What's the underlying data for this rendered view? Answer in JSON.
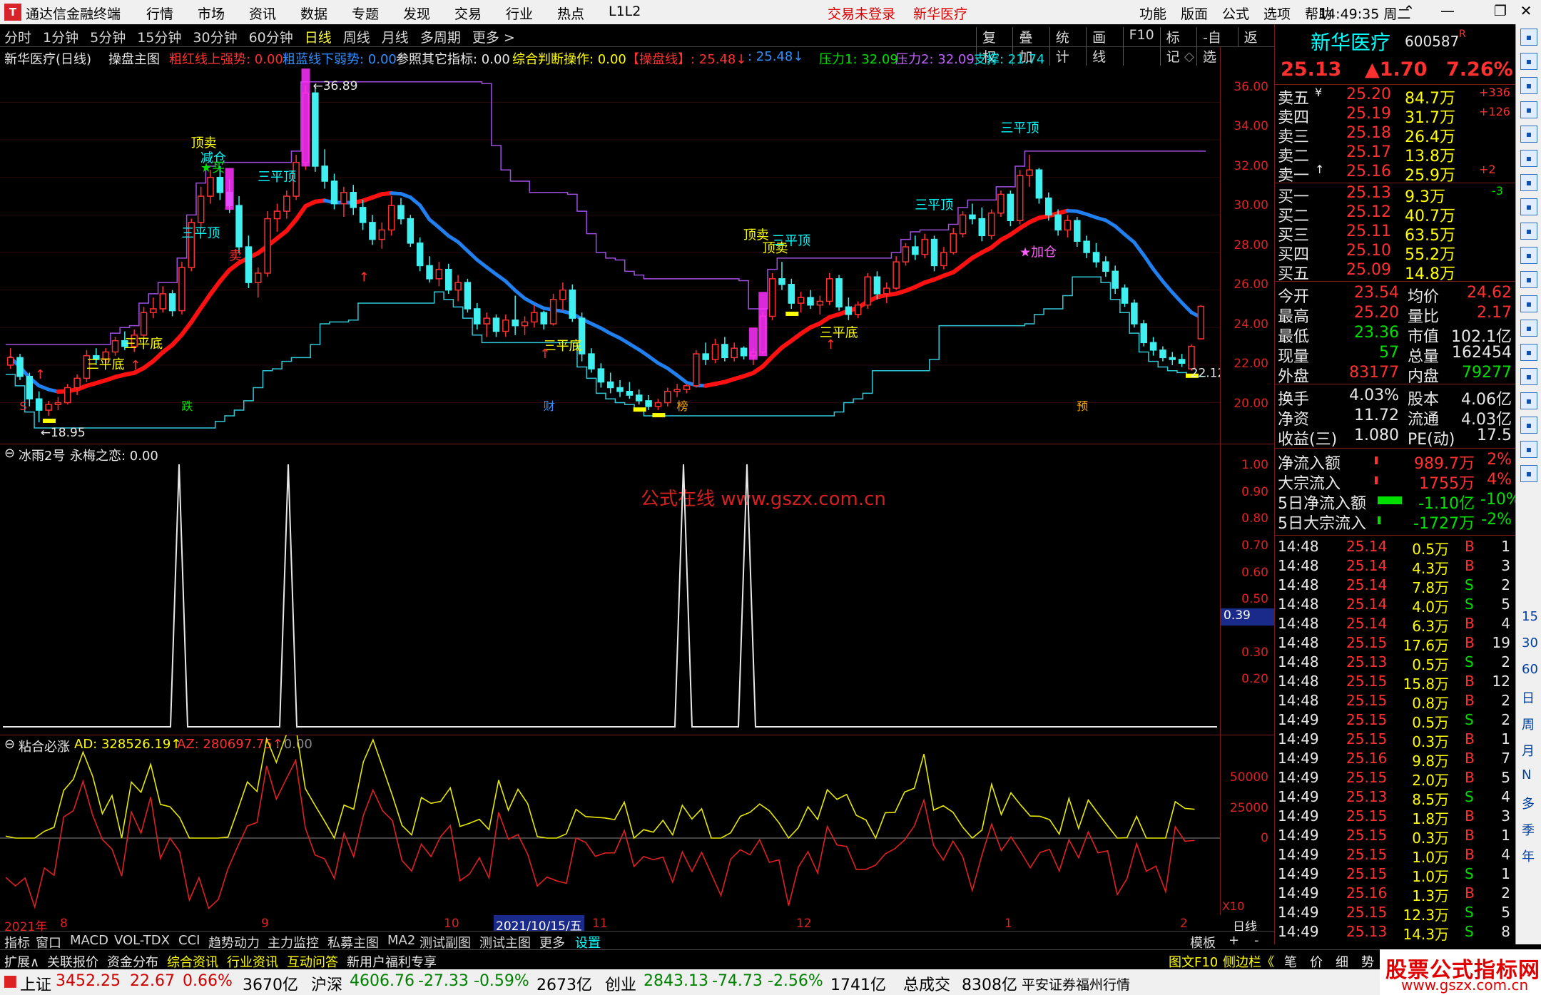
{
  "window": {
    "app_title": "通达信金融终端",
    "logo_glyph": "T",
    "menus": [
      "行情",
      "市场",
      "资讯",
      "数据",
      "专题",
      "发现",
      "交易",
      "行业",
      "热点",
      "L1L2"
    ],
    "alert_login": "交易未登录",
    "alert_stock": "新华医疗",
    "right_menus": [
      "功能",
      "版面",
      "公式",
      "选项",
      "帮助"
    ],
    "clock": "14:49:35 周二"
  },
  "toolbar": {
    "period_tabs": [
      "分时",
      "1分钟",
      "5分钟",
      "15分钟",
      "30分钟",
      "60分钟",
      "日线",
      "周线",
      "月线",
      "多周期",
      "更多 >"
    ],
    "active_tab": "日线",
    "right_tools": [
      "复权",
      "叠加",
      "统计",
      "画线",
      "F10",
      "标记",
      "-自选",
      "返回"
    ]
  },
  "main_chart": {
    "title": "新华医疗(日线)",
    "indicator_name": "操盘主图",
    "fields": [
      {
        "label": "粗红线上强势: 0.00",
        "color": "#ff3030"
      },
      {
        "label": "粗蓝线下弱势: 0.00",
        "color": "#3090ff"
      },
      {
        "label": "参照其它指标: 0.00",
        "color": "#e8e8e8"
      },
      {
        "label": "综合判断操作: 0.00",
        "color": "#ffff00"
      },
      {
        "label": "【操盘线】: 25.48↓",
        "color": "#ff3030"
      },
      {
        "label": ": 25.48↓",
        "color": "#3090ff"
      },
      {
        "label": "压力1: 32.09",
        "color": "#00e000"
      },
      {
        "label": "压力2: 32.09",
        "color": "#c060ff"
      },
      {
        "label": "支撑: 21.74",
        "color": "#00e0e0"
      }
    ],
    "y_axis": [
      "36.00",
      "34.00",
      "32.00",
      "30.00",
      "28.00",
      "26.00",
      "24.00",
      "22.00",
      "20.00"
    ],
    "high_label": "36.89",
    "low_label": "18.95",
    "last_label": "22.12",
    "annotations": [
      {
        "text": "顶卖",
        "color": "#ffff00"
      },
      {
        "text": "减仓",
        "color": "#00ffff"
      },
      {
        "text": "★买",
        "color": "#00e000"
      },
      {
        "text": "三平顶",
        "color": "#00ffff"
      },
      {
        "text": "三平顶",
        "color": "#00ffff"
      },
      {
        "text": "卖",
        "color": "#ff3030"
      },
      {
        "text": "三平底",
        "color": "#ffff00"
      },
      {
        "text": "三平底",
        "color": "#ffff00"
      },
      {
        "text": "三平底",
        "color": "#ffff00"
      },
      {
        "text": "顶卖",
        "color": "#ffff00"
      },
      {
        "text": "三平顶",
        "color": "#00ffff"
      },
      {
        "text": "顶卖",
        "color": "#ffff00"
      },
      {
        "text": "三平底",
        "color": "#ffff00"
      },
      {
        "text": "三平顶",
        "color": "#00ffff"
      },
      {
        "text": "三平顶",
        "color": "#00ffff"
      },
      {
        "text": "★加仓",
        "color": "#ff60ff"
      },
      {
        "text": "跌",
        "color": "#00e000"
      },
      {
        "text": "财",
        "color": "#3090ff"
      },
      {
        "text": "榜",
        "color": "#ffaa00"
      },
      {
        "text": "预",
        "color": "#ffaa00"
      },
      {
        "text": "S",
        "color": "#ff3030"
      }
    ]
  },
  "sub1": {
    "title": "冰雨2号",
    "field": "永梅之恋: 0.00",
    "y_axis": [
      "1.00",
      "0.90",
      "0.80",
      "0.70",
      "0.60",
      "0.50",
      "0.39",
      "0.30",
      "0.20"
    ],
    "watermark": "公式在线  www.gszx.com.cn"
  },
  "sub2": {
    "title": "粘合必涨",
    "ad": "AD: 328526.19↑",
    "az": "AZ: 280697.75↑",
    "zero": ": 0.00",
    "y_axis": [
      "50000",
      "25000",
      "0"
    ],
    "scale": "X10"
  },
  "date_axis": [
    "2021年",
    "8",
    "9",
    "10",
    "2021/10/15/五",
    "11",
    "12",
    "1",
    "2"
  ],
  "date_axis_right": "日线",
  "bottom_tabs1": [
    "指标",
    "窗口",
    "MACD",
    "VOL-TDX",
    "CCI",
    "趋势动力",
    "主力监控",
    "私募主图",
    "MA2",
    "测试副图",
    "测试主图",
    "更多",
    "设置"
  ],
  "bottom_tabs1_right": [
    "模板",
    "+",
    "-"
  ],
  "bottom_tabs2": [
    "扩展∧",
    "关联报价",
    "资金分布",
    "综合资讯",
    "行业资讯",
    "互动问答",
    "新用户福利专享"
  ],
  "bottom_tabs2_right": [
    "图文F10",
    "侧边栏《",
    "笔",
    "价",
    "细",
    "势"
  ],
  "quote": {
    "name": "新华医疗",
    "code": "600587",
    "code_flag": "R",
    "price": "25.13",
    "change": "▲1.70",
    "pct": "7.26%",
    "asks": [
      {
        "label": "卖五",
        "mark": "¥",
        "price": "25.20",
        "vol": "84.7万",
        "delta": "+336"
      },
      {
        "label": "卖四",
        "mark": "",
        "price": "25.19",
        "vol": "31.7万",
        "delta": "+126"
      },
      {
        "label": "卖三",
        "mark": "",
        "price": "25.18",
        "vol": "26.4万",
        "delta": ""
      },
      {
        "label": "卖二",
        "mark": "",
        "price": "25.17",
        "vol": "13.8万",
        "delta": ""
      },
      {
        "label": "卖一",
        "mark": "↑",
        "price": "25.16",
        "vol": "25.9万",
        "delta": "+2"
      }
    ],
    "bids": [
      {
        "label": "买一",
        "price": "25.13",
        "vol": "9.3万",
        "delta": "-3"
      },
      {
        "label": "买二",
        "price": "25.12",
        "vol": "40.7万",
        "delta": ""
      },
      {
        "label": "买三",
        "price": "25.11",
        "vol": "63.5万",
        "delta": ""
      },
      {
        "label": "买四",
        "price": "25.10",
        "vol": "55.2万",
        "delta": ""
      },
      {
        "label": "买五",
        "price": "25.09",
        "vol": "14.8万",
        "delta": ""
      }
    ],
    "stats": [
      {
        "l1": "今开",
        "v1": "23.54",
        "c1": "#ff3030",
        "l2": "均价",
        "v2": "24.62",
        "c2": "#ff3030"
      },
      {
        "l1": "最高",
        "v1": "25.20",
        "c1": "#ff3030",
        "l2": "量比",
        "v2": "2.17",
        "c2": "#ff3030"
      },
      {
        "l1": "最低",
        "v1": "23.36",
        "c1": "#00e000",
        "l2": "市值",
        "v2": "102.1亿",
        "c2": "#e8e8e8"
      },
      {
        "l1": "现量",
        "v1": "57",
        "c1": "#00e000",
        "l2": "总量",
        "v2": "162454",
        "c2": "#e8e8e8"
      },
      {
        "l1": "外盘",
        "v1": "83177",
        "c1": "#ff3030",
        "l2": "内盘",
        "v2": "79277",
        "c2": "#00e000"
      }
    ],
    "stats2": [
      {
        "l1": "换手",
        "v1": "4.03%",
        "l2": "股本",
        "v2": "4.06亿"
      },
      {
        "l1": "净资",
        "v1": "11.72",
        "l2": "流通",
        "v2": "4.03亿"
      },
      {
        "l1": "收益(三)",
        "v1": "1.080",
        "l2": "PE(动)",
        "v2": "17.5"
      }
    ],
    "flows": [
      {
        "label": "净流入额",
        "value": "989.7万",
        "pct": "2%",
        "color": "#ff3030"
      },
      {
        "label": "大宗流入",
        "value": "1755万",
        "pct": "4%",
        "color": "#ff3030"
      },
      {
        "label": "5日净流入额",
        "value": "-1.10亿",
        "pct": "-10%",
        "color": "#00e000"
      },
      {
        "label": "5日大宗流入",
        "value": "-1727万",
        "pct": "-2%",
        "color": "#00e000"
      }
    ],
    "ticks": [
      {
        "t": "14:48",
        "p": "25.14",
        "v": "0.5万",
        "d": "B",
        "n": "1"
      },
      {
        "t": "14:48",
        "p": "25.14",
        "v": "4.3万",
        "d": "B",
        "n": "3"
      },
      {
        "t": "14:48",
        "p": "25.14",
        "v": "7.8万",
        "d": "S",
        "n": "2"
      },
      {
        "t": "14:48",
        "p": "25.14",
        "v": "4.0万",
        "d": "S",
        "n": "5"
      },
      {
        "t": "14:48",
        "p": "25.14",
        "v": "6.3万",
        "d": "B",
        "n": "4"
      },
      {
        "t": "14:48",
        "p": "25.15",
        "v": "17.6万",
        "d": "B",
        "n": "19"
      },
      {
        "t": "14:48",
        "p": "25.13",
        "v": "0.5万",
        "d": "S",
        "n": "2"
      },
      {
        "t": "14:48",
        "p": "25.15",
        "v": "15.8万",
        "d": "B",
        "n": "12"
      },
      {
        "t": "14:48",
        "p": "25.15",
        "v": "0.8万",
        "d": "B",
        "n": "2"
      },
      {
        "t": "14:49",
        "p": "25.15",
        "v": "0.5万",
        "d": "S",
        "n": "2"
      },
      {
        "t": "14:49",
        "p": "25.15",
        "v": "0.3万",
        "d": "B",
        "n": "1"
      },
      {
        "t": "14:49",
        "p": "25.16",
        "v": "9.8万",
        "d": "B",
        "n": "7"
      },
      {
        "t": "14:49",
        "p": "25.15",
        "v": "2.0万",
        "d": "B",
        "n": "5"
      },
      {
        "t": "14:49",
        "p": "25.13",
        "v": "8.5万",
        "d": "S",
        "n": "4"
      },
      {
        "t": "14:49",
        "p": "25.15",
        "v": "1.8万",
        "d": "B",
        "n": "3"
      },
      {
        "t": "14:49",
        "p": "25.15",
        "v": "0.3万",
        "d": "B",
        "n": "1"
      },
      {
        "t": "14:49",
        "p": "25.15",
        "v": "1.0万",
        "d": "B",
        "n": "4"
      },
      {
        "t": "14:49",
        "p": "25.15",
        "v": "1.0万",
        "d": "S",
        "n": "1"
      },
      {
        "t": "14:49",
        "p": "25.16",
        "v": "1.3万",
        "d": "B",
        "n": "2"
      },
      {
        "t": "14:49",
        "p": "25.15",
        "v": "12.3万",
        "d": "S",
        "n": "5"
      },
      {
        "t": "14:49",
        "p": "25.13",
        "v": "14.3万",
        "d": "S",
        "n": "8"
      }
    ]
  },
  "sidebar": {
    "icons": [
      "back-arrow-icon",
      "up-icon",
      "down-icon",
      "table-icon",
      "chart-icon",
      "settings-icon",
      "calendar-icon",
      "grid-icon",
      "f10-icon",
      "list-icon",
      "fs-icon",
      "zoom-in-icon",
      "zoom-out-icon",
      "target-icon",
      "rsi-icon",
      "move-icon",
      "pen-icon",
      "sheet-icon",
      "refresh-icon"
    ],
    "period_labels": [
      "15",
      "30",
      "60",
      "日",
      "周",
      "月",
      "N",
      "多",
      "季",
      "年"
    ]
  },
  "status": {
    "sh_name": "上证",
    "sh_val": "3452.25",
    "sh_chg": "22.67",
    "sh_pct": "0.66%",
    "sh_amt": "3670亿",
    "sz_name": "沪深",
    "sz_val": "4606.76",
    "sz_chg": "-27.33",
    "sz_pct": "-0.59%",
    "sz_amt": "2673亿",
    "cy_name": "创业",
    "cy_val": "2843.13",
    "cy_chg": "-74.73",
    "cy_pct": "-2.56%",
    "cy_amt": "1741亿",
    "total_label": "总成交",
    "total_val": "8308亿",
    "broker": "平安证券福州行情"
  },
  "ad": {
    "line1": "股票公式指标网",
    "line2": "www.gszx.com.cn"
  },
  "chart_data": {
    "type": "candlestick",
    "title": "新华医疗(日线)",
    "ylim": [
      18.5,
      37.5
    ],
    "bars": [
      [
        22.0,
        22.9,
        21.8,
        22.4
      ],
      [
        22.4,
        22.6,
        21.2,
        21.4
      ],
      [
        21.4,
        21.6,
        19.8,
        20.2
      ],
      [
        20.2,
        20.6,
        18.95,
        19.6
      ],
      [
        19.6,
        20.1,
        19.3,
        19.9
      ],
      [
        19.9,
        20.3,
        19.6,
        20.0
      ],
      [
        20.0,
        21.0,
        19.9,
        20.8
      ],
      [
        20.8,
        21.5,
        20.4,
        21.3
      ],
      [
        21.3,
        22.8,
        21.1,
        22.5
      ],
      [
        22.5,
        22.9,
        22.0,
        22.3
      ],
      [
        22.3,
        22.9,
        22.1,
        22.7
      ],
      [
        22.7,
        23.5,
        22.5,
        23.3
      ],
      [
        23.3,
        23.8,
        22.8,
        23.0
      ],
      [
        23.0,
        23.9,
        22.7,
        23.6
      ],
      [
        23.6,
        25.1,
        23.4,
        24.8
      ],
      [
        24.8,
        25.6,
        24.5,
        25.0
      ],
      [
        25.0,
        26.2,
        24.8,
        25.8
      ],
      [
        25.8,
        26.0,
        24.6,
        24.9
      ],
      [
        24.9,
        27.5,
        24.7,
        27.2
      ],
      [
        27.2,
        29.8,
        27.0,
        29.6
      ],
      [
        29.6,
        31.5,
        29.3,
        31.0
      ],
      [
        31.0,
        32.4,
        30.6,
        32.0
      ],
      [
        32.0,
        32.6,
        30.8,
        31.2
      ],
      [
        31.2,
        31.9,
        30.1,
        30.5
      ],
      [
        30.5,
        31.0,
        28.0,
        28.3
      ],
      [
        28.3,
        28.9,
        26.1,
        26.4
      ],
      [
        26.4,
        27.2,
        25.6,
        26.9
      ],
      [
        26.9,
        30.2,
        26.7,
        29.8
      ],
      [
        29.8,
        30.6,
        29.1,
        30.2
      ],
      [
        30.2,
        31.3,
        29.8,
        31.0
      ],
      [
        31.0,
        33.2,
        30.8,
        32.8
      ],
      [
        32.8,
        36.89,
        32.4,
        36.5
      ],
      [
        36.5,
        36.8,
        32.3,
        32.6
      ],
      [
        32.6,
        33.5,
        31.4,
        31.8
      ],
      [
        31.8,
        32.2,
        30.3,
        30.6
      ],
      [
        30.6,
        31.5,
        29.9,
        31.2
      ],
      [
        31.2,
        31.6,
        30.0,
        30.4
      ],
      [
        30.4,
        30.8,
        29.2,
        29.6
      ],
      [
        29.6,
        30.0,
        28.4,
        28.7
      ],
      [
        28.7,
        29.6,
        28.2,
        29.2
      ],
      [
        29.2,
        31.0,
        28.9,
        30.5
      ],
      [
        30.5,
        30.9,
        29.5,
        29.8
      ],
      [
        29.8,
        30.0,
        28.3,
        28.5
      ],
      [
        28.5,
        28.8,
        27.0,
        27.3
      ],
      [
        27.3,
        27.8,
        26.4,
        26.6
      ],
      [
        26.6,
        27.5,
        26.2,
        27.1
      ],
      [
        27.1,
        27.4,
        25.8,
        26.0
      ],
      [
        26.0,
        26.8,
        25.4,
        26.4
      ],
      [
        26.4,
        26.6,
        24.8,
        25.0
      ],
      [
        25.0,
        25.3,
        23.9,
        24.2
      ],
      [
        24.2,
        24.8,
        23.5,
        24.5
      ],
      [
        24.5,
        24.7,
        23.5,
        23.8
      ],
      [
        23.8,
        24.7,
        23.5,
        24.4
      ],
      [
        24.4,
        25.7,
        23.6,
        24.1
      ],
      [
        24.1,
        24.6,
        23.6,
        24.3
      ],
      [
        24.3,
        25.2,
        24.0,
        24.8
      ],
      [
        24.8,
        24.9,
        23.9,
        24.2
      ],
      [
        24.2,
        25.8,
        24.1,
        25.5
      ],
      [
        25.5,
        26.4,
        24.9,
        26.0
      ],
      [
        26.0,
        26.3,
        24.3,
        24.5
      ],
      [
        24.5,
        24.8,
        22.2,
        22.6
      ],
      [
        22.6,
        22.9,
        21.6,
        21.8
      ],
      [
        21.8,
        22.1,
        20.8,
        21.1
      ],
      [
        21.1,
        21.6,
        20.5,
        20.8
      ],
      [
        20.8,
        21.2,
        20.3,
        20.6
      ],
      [
        20.6,
        21.1,
        20.2,
        20.4
      ],
      [
        20.4,
        20.7,
        19.9,
        20.1
      ],
      [
        20.1,
        20.4,
        19.6,
        19.8
      ],
      [
        19.8,
        20.2,
        19.6,
        20.0
      ],
      [
        20.0,
        20.8,
        19.8,
        20.6
      ],
      [
        20.6,
        21.0,
        20.3,
        20.7
      ],
      [
        20.7,
        21.0,
        20.5,
        20.9
      ],
      [
        20.9,
        22.8,
        20.8,
        22.6
      ],
      [
        22.6,
        23.2,
        22.0,
        22.3
      ],
      [
        22.3,
        23.4,
        22.1,
        23.1
      ],
      [
        23.1,
        23.5,
        22.2,
        22.4
      ],
      [
        22.4,
        23.2,
        22.2,
        22.9
      ],
      [
        22.9,
        23.0,
        22.3,
        22.5
      ],
      [
        22.5,
        22.9,
        22.0,
        22.7
      ],
      [
        22.7,
        24.8,
        22.6,
        24.6
      ],
      [
        24.6,
        26.9,
        24.4,
        26.6
      ],
      [
        26.6,
        27.5,
        26.0,
        26.3
      ],
      [
        26.3,
        26.6,
        25.0,
        25.3
      ],
      [
        25.3,
        25.9,
        24.8,
        25.6
      ],
      [
        25.6,
        26.0,
        25.0,
        25.2
      ],
      [
        25.2,
        25.7,
        24.7,
        25.4
      ],
      [
        25.4,
        26.9,
        25.2,
        26.6
      ],
      [
        26.6,
        26.8,
        24.9,
        25.1
      ],
      [
        25.1,
        25.6,
        24.4,
        24.7
      ],
      [
        24.7,
        25.4,
        24.5,
        25.2
      ],
      [
        25.2,
        26.9,
        25.0,
        26.7
      ],
      [
        26.7,
        27.0,
        25.5,
        25.8
      ],
      [
        25.8,
        26.4,
        25.3,
        26.1
      ],
      [
        26.1,
        27.8,
        26.0,
        27.5
      ],
      [
        27.5,
        28.5,
        27.3,
        28.3
      ],
      [
        28.3,
        28.9,
        27.6,
        27.9
      ],
      [
        27.9,
        29.0,
        27.7,
        28.7
      ],
      [
        28.7,
        28.9,
        27.0,
        27.3
      ],
      [
        27.3,
        28.3,
        27.1,
        28.0
      ],
      [
        28.0,
        29.3,
        27.9,
        29.0
      ],
      [
        29.0,
        30.2,
        28.8,
        30.0
      ],
      [
        30.0,
        30.6,
        29.5,
        29.8
      ],
      [
        29.8,
        30.4,
        28.6,
        28.9
      ],
      [
        28.9,
        30.3,
        28.7,
        30.1
      ],
      [
        30.1,
        31.3,
        29.9,
        31.1
      ],
      [
        31.1,
        31.3,
        29.4,
        29.7
      ],
      [
        29.7,
        32.4,
        29.5,
        32.1
      ],
      [
        32.1,
        33.2,
        31.5,
        32.4
      ],
      [
        32.4,
        32.5,
        30.6,
        30.9
      ],
      [
        30.9,
        31.2,
        29.7,
        30.0
      ],
      [
        30.0,
        30.3,
        28.9,
        29.2
      ],
      [
        29.2,
        30.0,
        28.8,
        29.7
      ],
      [
        29.7,
        29.9,
        28.3,
        28.6
      ],
      [
        28.6,
        28.9,
        27.7,
        28.0
      ],
      [
        28.0,
        28.5,
        27.2,
        27.5
      ],
      [
        27.5,
        27.8,
        26.7,
        27.0
      ],
      [
        27.0,
        27.3,
        25.8,
        26.1
      ],
      [
        26.1,
        26.3,
        25.1,
        25.3
      ],
      [
        25.3,
        25.5,
        24.0,
        24.2
      ],
      [
        24.2,
        24.4,
        23.0,
        23.2
      ],
      [
        23.2,
        23.5,
        22.5,
        22.8
      ],
      [
        22.8,
        23.0,
        22.2,
        22.4
      ],
      [
        22.4,
        22.7,
        22.0,
        22.3
      ],
      [
        22.3,
        22.6,
        21.9,
        22.1
      ],
      [
        21.8,
        23.1,
        21.7,
        23.0
      ],
      [
        23.4,
        25.2,
        23.36,
        25.13
      ]
    ]
  }
}
